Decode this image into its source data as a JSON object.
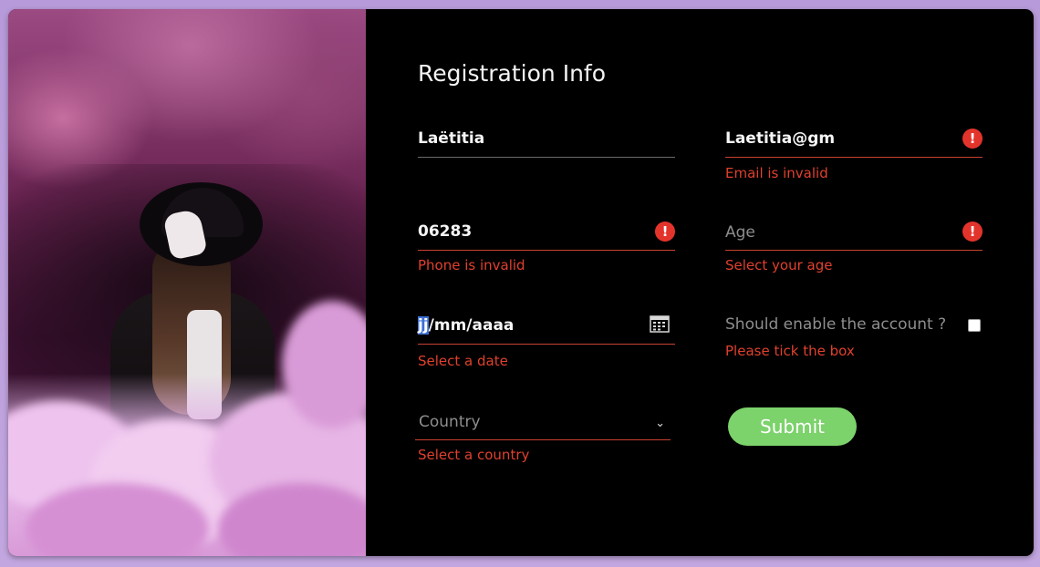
{
  "form": {
    "title": "Registration Info",
    "first_name": {
      "value": "Laëtitia"
    },
    "email": {
      "value": "Laetitia@gm",
      "error": "Email is invalid"
    },
    "phone": {
      "value": "06283",
      "error": "Phone is invalid"
    },
    "age": {
      "placeholder": "Age",
      "error": "Select your age"
    },
    "date": {
      "value_selected": "jj",
      "value_rest": "/mm/aaaa",
      "error": "Select a date"
    },
    "enable_account": {
      "label": "Should enable the account ?",
      "checked": false,
      "error": "Please tick the box"
    },
    "country": {
      "placeholder": "Country",
      "error": "Select a country"
    },
    "submit_label": "Submit"
  },
  "colors": {
    "error": "#e0402e",
    "submit": "#7cd26b",
    "background": "#000000",
    "page": "#c2a6df"
  },
  "icons": {
    "error": "exclamation-circle-icon",
    "date": "calendar-icon",
    "country": "chevron-down-icon"
  }
}
